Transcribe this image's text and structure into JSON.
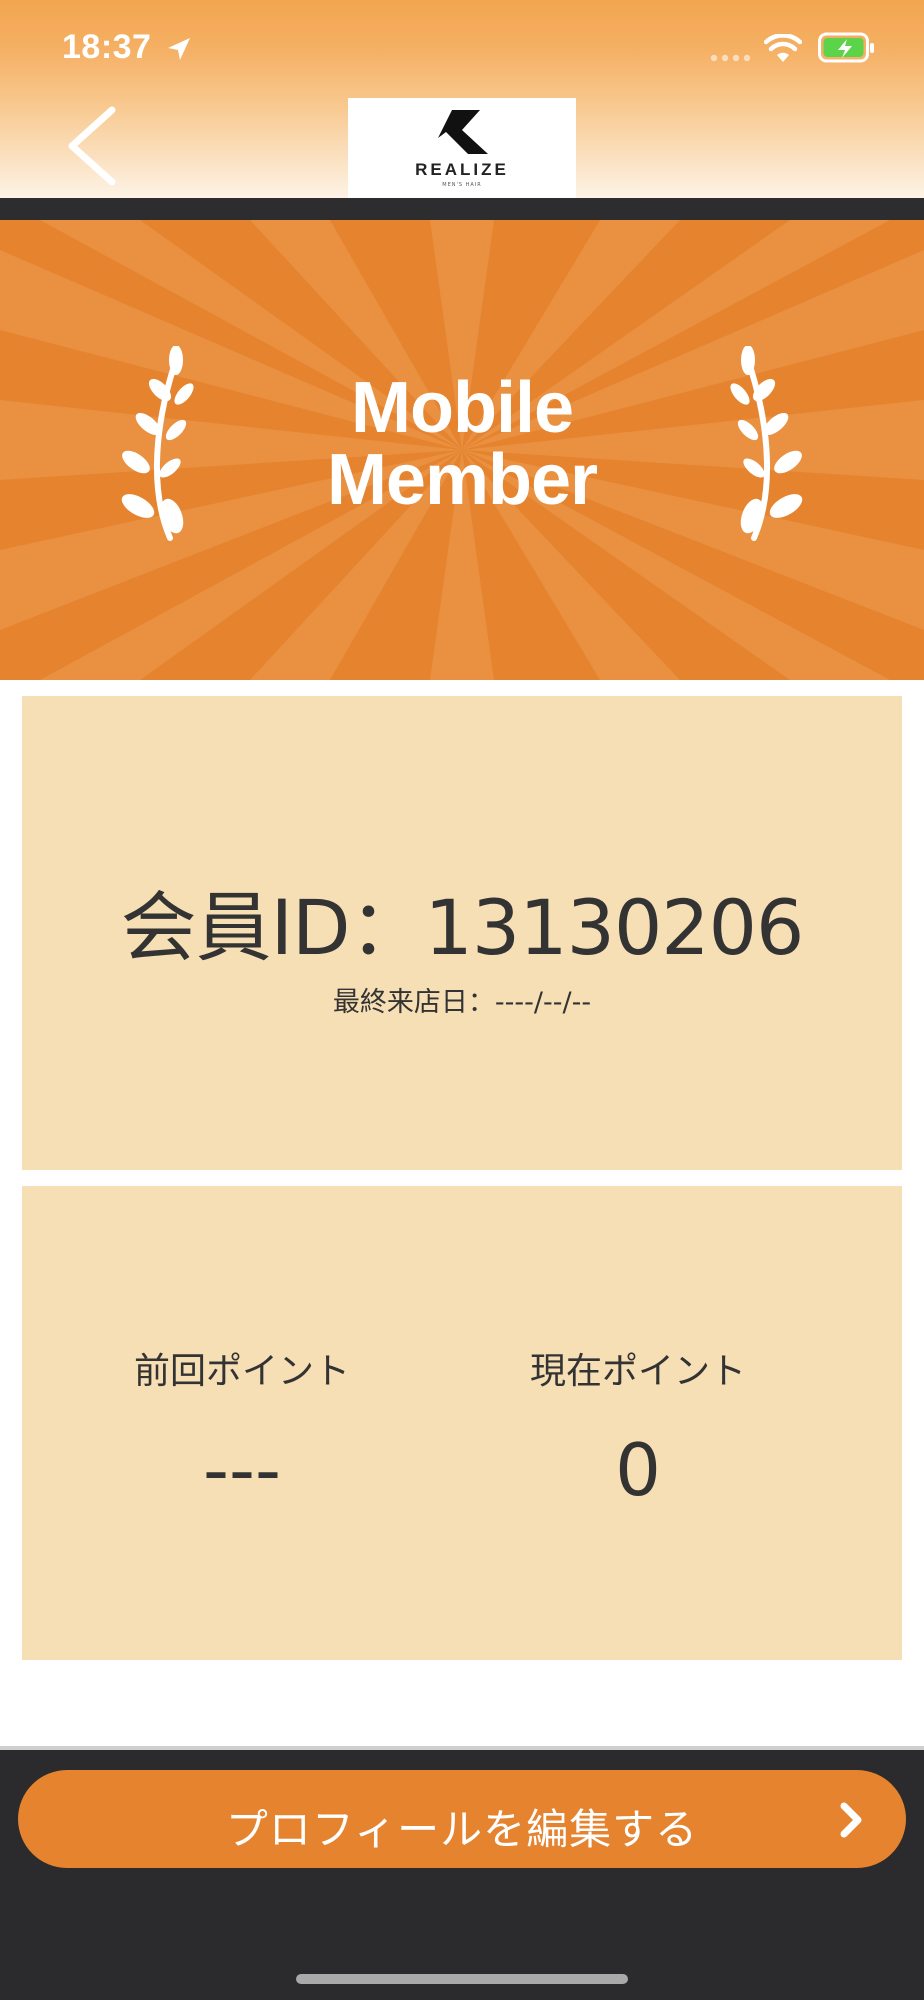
{
  "status_bar": {
    "time": "18:37"
  },
  "header": {
    "logo_text": "REALIZE",
    "logo_subtext": "MEN'S HAIR"
  },
  "banner": {
    "title_line1": "Mobile",
    "title_line2": "Member"
  },
  "member_card": {
    "member_id": "会員ID：13130206",
    "last_visit": "最終来店日：----/--/--"
  },
  "points_card": {
    "previous_label": "前回ポイント",
    "previous_value": "---",
    "current_label": "現在ポイント",
    "current_value": "0"
  },
  "footer": {
    "edit_profile_label": "プロフィールを編集する"
  },
  "colors": {
    "accent_orange": "#e5832f",
    "card_beige": "#f7dfb5",
    "dark_footer": "#2b2b2d"
  }
}
